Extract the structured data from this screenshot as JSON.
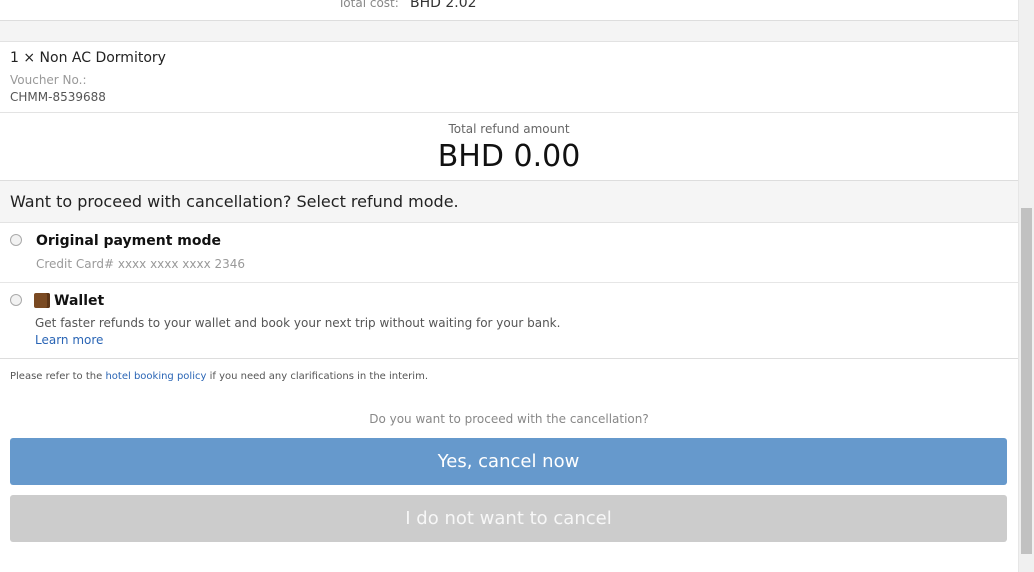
{
  "summary": {
    "total_cost_label": "Total cost:",
    "total_cost_value": "BHD 2.02"
  },
  "room": {
    "title": "1 × Non AC Dormitory",
    "voucher_label": "Voucher No.:",
    "voucher_value": "CHMM-8539688"
  },
  "refund": {
    "label": "Total refund amount",
    "amount": "BHD 0.00"
  },
  "refund_mode": {
    "question": "Want to proceed with cancellation? Select refund mode.",
    "options": [
      {
        "title": "Original payment mode",
        "subtitle": "Credit Card# xxxx xxxx xxxx 2346",
        "selected": false
      },
      {
        "title": "Wallet",
        "icon": "wallet-icon",
        "description": "Get faster refunds to your wallet and book your next trip without waiting for your bank.",
        "link": "Learn more",
        "selected": false
      }
    ]
  },
  "policy": {
    "prefix": "Please refer to the ",
    "link": "hotel booking policy",
    "suffix": " if you need any clarifications in the interim."
  },
  "confirm": {
    "question": "Do you want to proceed with the cancellation?",
    "yes_label": "Yes, cancel now",
    "no_label": "I do not want to cancel"
  },
  "colors": {
    "primary": "#6699cc",
    "secondary": "#cccccc",
    "link": "#2a65b5"
  }
}
